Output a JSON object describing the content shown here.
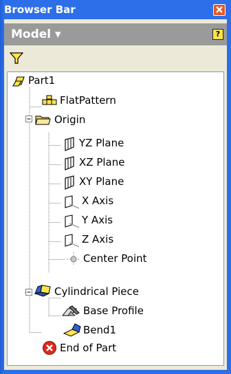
{
  "window": {
    "title": "Browser Bar"
  },
  "header": {
    "mode_label": "Model ▾",
    "help_label": "?"
  },
  "tree": {
    "root": "Part1",
    "flat_pattern": "FlatPattern",
    "origin": {
      "label": "Origin",
      "children": [
        "YZ Plane",
        "XZ Plane",
        "XY Plane",
        "X Axis",
        "Y Axis",
        "Z Axis",
        "Center Point"
      ]
    },
    "cylindrical_piece": {
      "label": "Cylindrical Piece",
      "children": [
        "Base Profile",
        "Bend1"
      ]
    },
    "end": "End of Part"
  },
  "colors": {
    "titlebar": "#2d6fe8",
    "header": "#9a9a9a",
    "client": "#ece9d8",
    "filter": "#ffe44a"
  }
}
